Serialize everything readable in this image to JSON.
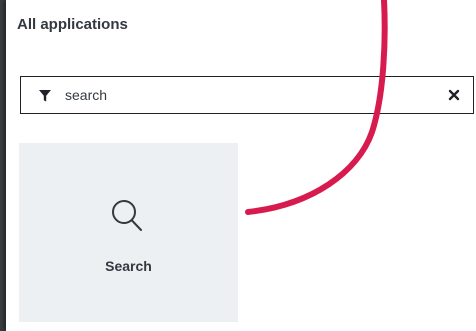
{
  "panel": {
    "title": "All applications"
  },
  "filter": {
    "value": "search",
    "icon": "filter-icon",
    "clear_icon": "close-icon"
  },
  "tiles": [
    {
      "label": "Search",
      "icon": "search-icon"
    }
  ],
  "colors": {
    "annotation_arrow": "#d81b4f",
    "tile_background": "#edf0f3",
    "text": "#333940"
  }
}
